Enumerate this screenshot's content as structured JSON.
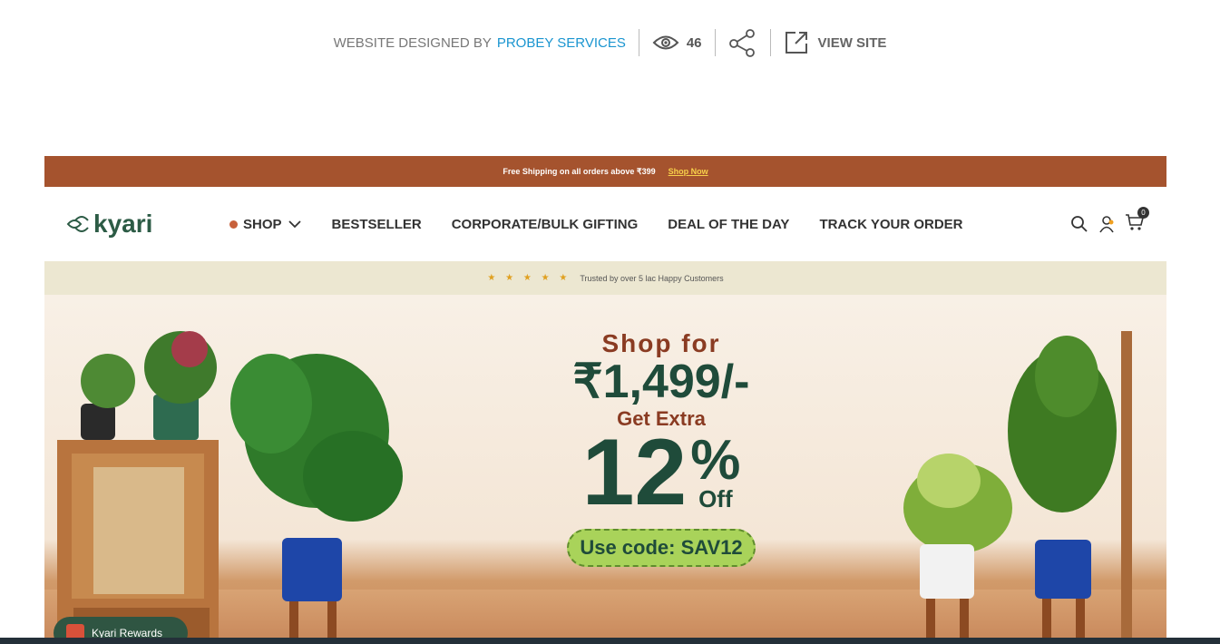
{
  "meta": {
    "credit_prefix": "WEBSITE DESIGNED BY",
    "credit_name": "PROBEY SERVICES",
    "views": "46",
    "visit_label": "VIEW SITE",
    "icons": {
      "views": "eye-icon",
      "share": "share-icon",
      "visit": "external-link-icon"
    }
  },
  "site": {
    "announcement": "Free Shipping on all orders above ₹399",
    "announcement_link": "Shop Now",
    "logo_text": "kyari",
    "nav": [
      "SHOP",
      "BESTSELLER",
      "CORPORATE/BULK GIFTING",
      "DEAL OF THE DAY",
      "TRACK YOUR ORDER"
    ],
    "cart_count": "0",
    "trust_stars": "★ ★ ★ ★ ★",
    "trust_text": "Trusted by over 5 lac Happy Customers",
    "hero": {
      "line1": "Shop for",
      "price": "₹1,499/-",
      "line3": "Get Extra",
      "discount": "12",
      "percent": "%",
      "off": "Off",
      "code": "Use code: SAV12"
    },
    "rewards_label": "Kyari Rewards"
  },
  "colors": {
    "announcement_bg": "#a5532e",
    "brand_green": "#1f4b3a",
    "link_blue": "#1a95d0",
    "code_bg": "#a9d35a"
  }
}
